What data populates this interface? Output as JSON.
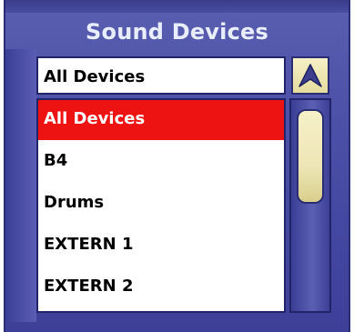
{
  "panel": {
    "title": "Sound Devices"
  },
  "selector": {
    "selected_value": "All Devices"
  },
  "list": {
    "items": [
      "All Devices",
      "B4",
      "Drums",
      "EXTERN 1",
      "EXTERN 2"
    ],
    "selected_index": 0
  },
  "colors": {
    "panel_blue": "#4b4fa6",
    "title_text": "#e9eeff",
    "selected_row": "#ee1313",
    "scroll_thumb": "#f0e8b8"
  },
  "icons": {
    "scroll_up": "up-arrow-icon"
  }
}
